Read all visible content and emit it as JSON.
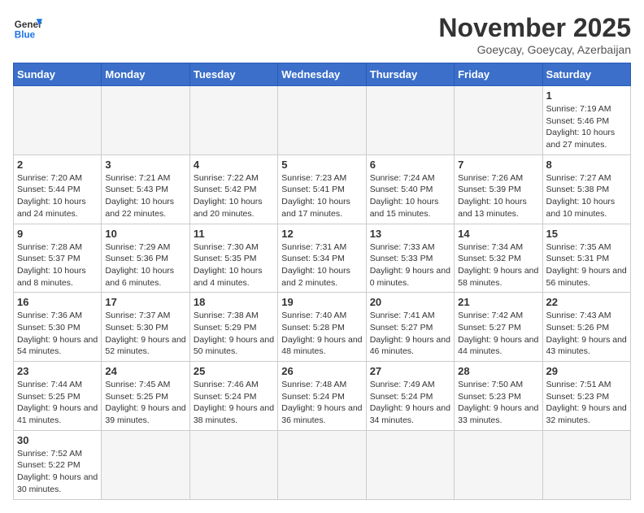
{
  "header": {
    "logo_general": "General",
    "logo_blue": "Blue",
    "month_title": "November 2025",
    "location": "Goeycay, Goeycay, Azerbaijan"
  },
  "days_of_week": [
    "Sunday",
    "Monday",
    "Tuesday",
    "Wednesday",
    "Thursday",
    "Friday",
    "Saturday"
  ],
  "weeks": [
    {
      "days": [
        {
          "number": "",
          "info": ""
        },
        {
          "number": "",
          "info": ""
        },
        {
          "number": "",
          "info": ""
        },
        {
          "number": "",
          "info": ""
        },
        {
          "number": "",
          "info": ""
        },
        {
          "number": "",
          "info": ""
        },
        {
          "number": "1",
          "info": "Sunrise: 7:19 AM\nSunset: 5:46 PM\nDaylight: 10 hours and 27 minutes."
        }
      ]
    },
    {
      "days": [
        {
          "number": "2",
          "info": "Sunrise: 7:20 AM\nSunset: 5:44 PM\nDaylight: 10 hours and 24 minutes."
        },
        {
          "number": "3",
          "info": "Sunrise: 7:21 AM\nSunset: 5:43 PM\nDaylight: 10 hours and 22 minutes."
        },
        {
          "number": "4",
          "info": "Sunrise: 7:22 AM\nSunset: 5:42 PM\nDaylight: 10 hours and 20 minutes."
        },
        {
          "number": "5",
          "info": "Sunrise: 7:23 AM\nSunset: 5:41 PM\nDaylight: 10 hours and 17 minutes."
        },
        {
          "number": "6",
          "info": "Sunrise: 7:24 AM\nSunset: 5:40 PM\nDaylight: 10 hours and 15 minutes."
        },
        {
          "number": "7",
          "info": "Sunrise: 7:26 AM\nSunset: 5:39 PM\nDaylight: 10 hours and 13 minutes."
        },
        {
          "number": "8",
          "info": "Sunrise: 7:27 AM\nSunset: 5:38 PM\nDaylight: 10 hours and 10 minutes."
        }
      ]
    },
    {
      "days": [
        {
          "number": "9",
          "info": "Sunrise: 7:28 AM\nSunset: 5:37 PM\nDaylight: 10 hours and 8 minutes."
        },
        {
          "number": "10",
          "info": "Sunrise: 7:29 AM\nSunset: 5:36 PM\nDaylight: 10 hours and 6 minutes."
        },
        {
          "number": "11",
          "info": "Sunrise: 7:30 AM\nSunset: 5:35 PM\nDaylight: 10 hours and 4 minutes."
        },
        {
          "number": "12",
          "info": "Sunrise: 7:31 AM\nSunset: 5:34 PM\nDaylight: 10 hours and 2 minutes."
        },
        {
          "number": "13",
          "info": "Sunrise: 7:33 AM\nSunset: 5:33 PM\nDaylight: 9 hours and 0 minutes."
        },
        {
          "number": "14",
          "info": "Sunrise: 7:34 AM\nSunset: 5:32 PM\nDaylight: 9 hours and 58 minutes."
        },
        {
          "number": "15",
          "info": "Sunrise: 7:35 AM\nSunset: 5:31 PM\nDaylight: 9 hours and 56 minutes."
        }
      ]
    },
    {
      "days": [
        {
          "number": "16",
          "info": "Sunrise: 7:36 AM\nSunset: 5:30 PM\nDaylight: 9 hours and 54 minutes."
        },
        {
          "number": "17",
          "info": "Sunrise: 7:37 AM\nSunset: 5:30 PM\nDaylight: 9 hours and 52 minutes."
        },
        {
          "number": "18",
          "info": "Sunrise: 7:38 AM\nSunset: 5:29 PM\nDaylight: 9 hours and 50 minutes."
        },
        {
          "number": "19",
          "info": "Sunrise: 7:40 AM\nSunset: 5:28 PM\nDaylight: 9 hours and 48 minutes."
        },
        {
          "number": "20",
          "info": "Sunrise: 7:41 AM\nSunset: 5:27 PM\nDaylight: 9 hours and 46 minutes."
        },
        {
          "number": "21",
          "info": "Sunrise: 7:42 AM\nSunset: 5:27 PM\nDaylight: 9 hours and 44 minutes."
        },
        {
          "number": "22",
          "info": "Sunrise: 7:43 AM\nSunset: 5:26 PM\nDaylight: 9 hours and 43 minutes."
        }
      ]
    },
    {
      "days": [
        {
          "number": "23",
          "info": "Sunrise: 7:44 AM\nSunset: 5:25 PM\nDaylight: 9 hours and 41 minutes."
        },
        {
          "number": "24",
          "info": "Sunrise: 7:45 AM\nSunset: 5:25 PM\nDaylight: 9 hours and 39 minutes."
        },
        {
          "number": "25",
          "info": "Sunrise: 7:46 AM\nSunset: 5:24 PM\nDaylight: 9 hours and 38 minutes."
        },
        {
          "number": "26",
          "info": "Sunrise: 7:48 AM\nSunset: 5:24 PM\nDaylight: 9 hours and 36 minutes."
        },
        {
          "number": "27",
          "info": "Sunrise: 7:49 AM\nSunset: 5:24 PM\nDaylight: 9 hours and 34 minutes."
        },
        {
          "number": "28",
          "info": "Sunrise: 7:50 AM\nSunset: 5:23 PM\nDaylight: 9 hours and 33 minutes."
        },
        {
          "number": "29",
          "info": "Sunrise: 7:51 AM\nSunset: 5:23 PM\nDaylight: 9 hours and 32 minutes."
        }
      ]
    },
    {
      "days": [
        {
          "number": "30",
          "info": "Sunrise: 7:52 AM\nSunset: 5:22 PM\nDaylight: 9 hours and 30 minutes."
        },
        {
          "number": "",
          "info": ""
        },
        {
          "number": "",
          "info": ""
        },
        {
          "number": "",
          "info": ""
        },
        {
          "number": "",
          "info": ""
        },
        {
          "number": "",
          "info": ""
        },
        {
          "number": "",
          "info": ""
        }
      ]
    }
  ]
}
